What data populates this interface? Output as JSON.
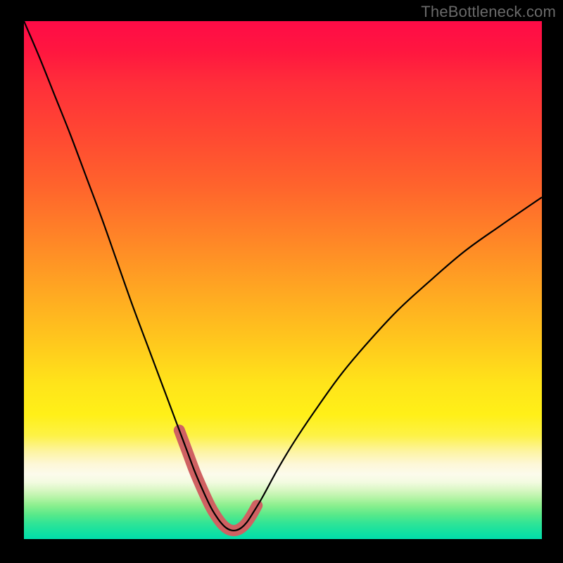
{
  "watermark": "TheBottleneck.com",
  "colors": {
    "background_frame": "#000000",
    "watermark_text": "#6a6a6a",
    "curve": "#000000",
    "highlight_blob": "#cf6162",
    "gradient_top": "#ff0b47",
    "gradient_bottom": "#02ddac"
  },
  "chart_data": {
    "type": "line",
    "title": "",
    "xlabel": "",
    "ylabel": "",
    "x_range": [
      0,
      100
    ],
    "y_range": [
      0,
      100
    ],
    "series": [
      {
        "name": "bottleneck-curve",
        "x": [
          0,
          3,
          6,
          9,
          12,
          15,
          18,
          21,
          24,
          27,
          30,
          31.5,
          33,
          34.5,
          36,
          37,
          38,
          39,
          40,
          41,
          42,
          43,
          44,
          46,
          49,
          52,
          56,
          61,
          66,
          72,
          78,
          85,
          92,
          100
        ],
        "y": [
          100,
          93,
          85.5,
          78,
          70,
          62,
          53.5,
          45,
          37,
          29,
          21,
          17,
          13,
          9.5,
          6.3,
          4.6,
          3.2,
          2.2,
          1.7,
          1.7,
          2.2,
          3.2,
          4.7,
          8,
          13.5,
          18.5,
          24.5,
          31.5,
          37.5,
          44,
          49.5,
          55.5,
          60.5,
          66
        ]
      }
    ],
    "highlight_region": {
      "description": "bottom-of-valley marker",
      "x": [
        30,
        31.5,
        33,
        34.5,
        36,
        37,
        38,
        39,
        40,
        41,
        42,
        43,
        44,
        45
      ],
      "y": [
        21,
        17,
        13,
        9.5,
        6.3,
        4.6,
        3.2,
        2.2,
        1.7,
        1.7,
        2.2,
        3.2,
        4.7,
        6.5
      ]
    },
    "annotations": []
  }
}
